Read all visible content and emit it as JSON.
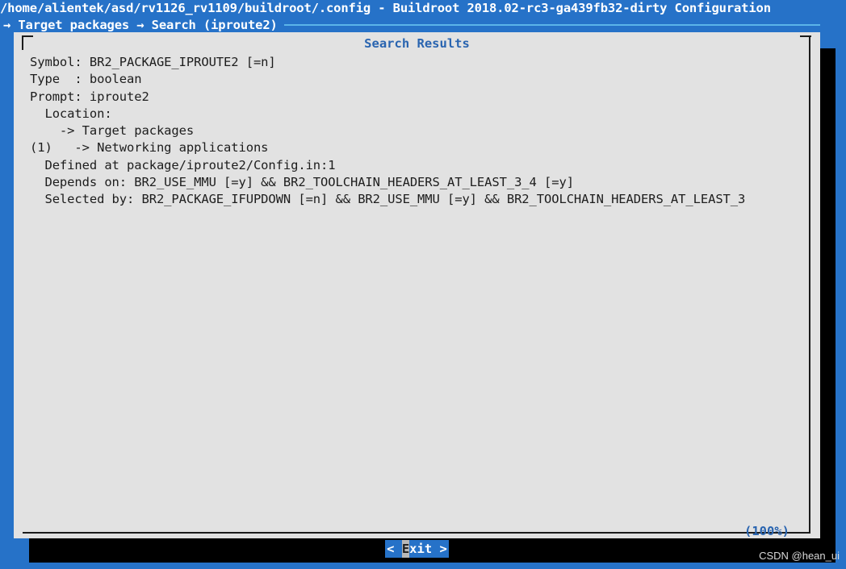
{
  "window": {
    "title": "/home/alientek/asd/rv1126_rv1109/buildroot/.config - Buildroot 2018.02-rc3-ga439fb32-dirty Configuration",
    "breadcrumb": "→ Target packages → Search (iproute2)"
  },
  "dialog": {
    "title": "Search Results",
    "lines": [
      "Symbol: BR2_PACKAGE_IPROUTE2 [=n]",
      "Type  : boolean",
      "Prompt: iproute2",
      "  Location:",
      "    -> Target packages",
      "(1)   -> Networking applications",
      "  Defined at package/iproute2/Config.in:1",
      "  Depends on: BR2_USE_MMU [=y] && BR2_TOOLCHAIN_HEADERS_AT_LEAST_3_4 [=y]",
      "  Selected by: BR2_PACKAGE_IFUPDOWN [=n] && BR2_USE_MMU [=y] && BR2_TOOLCHAIN_HEADERS_AT_LEAST_3"
    ],
    "scroll_percent": "(100%)",
    "exit_button": {
      "prefix": "< ",
      "hotkey": "E",
      "rest": "xit >"
    }
  },
  "watermark": "CSDN @hean_ui",
  "colors": {
    "screen_blue": "#2672c8",
    "dialog_bg": "#e2e2e2",
    "accent_blue": "#2964b0",
    "rule_blue": "#5bb4e8",
    "text_black": "#1d1d1d",
    "terminal_black": "#000000"
  }
}
